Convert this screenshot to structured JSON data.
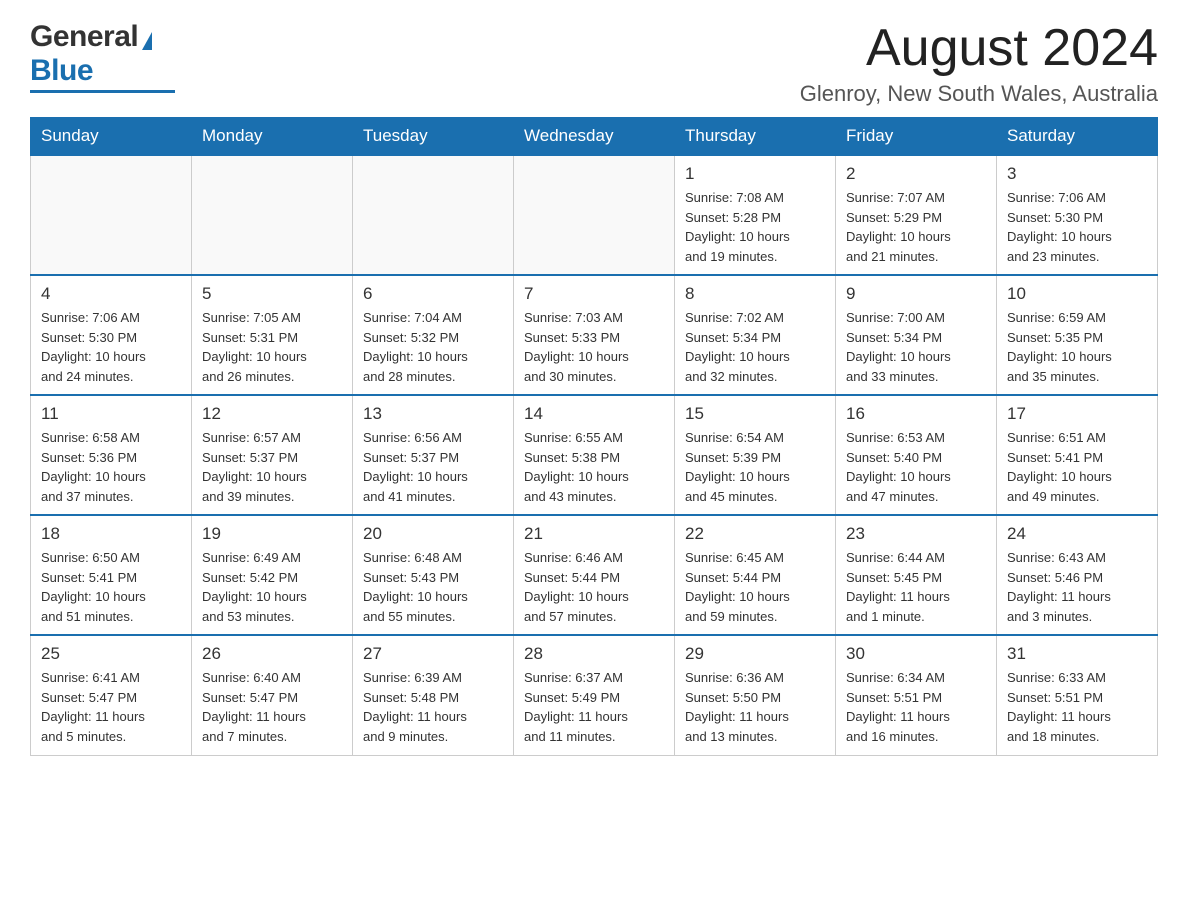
{
  "header": {
    "month_title": "August 2024",
    "location": "Glenroy, New South Wales, Australia"
  },
  "logo": {
    "general": "General",
    "blue": "Blue"
  },
  "days_of_week": [
    "Sunday",
    "Monday",
    "Tuesday",
    "Wednesday",
    "Thursday",
    "Friday",
    "Saturday"
  ],
  "weeks": [
    [
      {
        "day": "",
        "info": ""
      },
      {
        "day": "",
        "info": ""
      },
      {
        "day": "",
        "info": ""
      },
      {
        "day": "",
        "info": ""
      },
      {
        "day": "1",
        "info": "Sunrise: 7:08 AM\nSunset: 5:28 PM\nDaylight: 10 hours\nand 19 minutes."
      },
      {
        "day": "2",
        "info": "Sunrise: 7:07 AM\nSunset: 5:29 PM\nDaylight: 10 hours\nand 21 minutes."
      },
      {
        "day": "3",
        "info": "Sunrise: 7:06 AM\nSunset: 5:30 PM\nDaylight: 10 hours\nand 23 minutes."
      }
    ],
    [
      {
        "day": "4",
        "info": "Sunrise: 7:06 AM\nSunset: 5:30 PM\nDaylight: 10 hours\nand 24 minutes."
      },
      {
        "day": "5",
        "info": "Sunrise: 7:05 AM\nSunset: 5:31 PM\nDaylight: 10 hours\nand 26 minutes."
      },
      {
        "day": "6",
        "info": "Sunrise: 7:04 AM\nSunset: 5:32 PM\nDaylight: 10 hours\nand 28 minutes."
      },
      {
        "day": "7",
        "info": "Sunrise: 7:03 AM\nSunset: 5:33 PM\nDaylight: 10 hours\nand 30 minutes."
      },
      {
        "day": "8",
        "info": "Sunrise: 7:02 AM\nSunset: 5:34 PM\nDaylight: 10 hours\nand 32 minutes."
      },
      {
        "day": "9",
        "info": "Sunrise: 7:00 AM\nSunset: 5:34 PM\nDaylight: 10 hours\nand 33 minutes."
      },
      {
        "day": "10",
        "info": "Sunrise: 6:59 AM\nSunset: 5:35 PM\nDaylight: 10 hours\nand 35 minutes."
      }
    ],
    [
      {
        "day": "11",
        "info": "Sunrise: 6:58 AM\nSunset: 5:36 PM\nDaylight: 10 hours\nand 37 minutes."
      },
      {
        "day": "12",
        "info": "Sunrise: 6:57 AM\nSunset: 5:37 PM\nDaylight: 10 hours\nand 39 minutes."
      },
      {
        "day": "13",
        "info": "Sunrise: 6:56 AM\nSunset: 5:37 PM\nDaylight: 10 hours\nand 41 minutes."
      },
      {
        "day": "14",
        "info": "Sunrise: 6:55 AM\nSunset: 5:38 PM\nDaylight: 10 hours\nand 43 minutes."
      },
      {
        "day": "15",
        "info": "Sunrise: 6:54 AM\nSunset: 5:39 PM\nDaylight: 10 hours\nand 45 minutes."
      },
      {
        "day": "16",
        "info": "Sunrise: 6:53 AM\nSunset: 5:40 PM\nDaylight: 10 hours\nand 47 minutes."
      },
      {
        "day": "17",
        "info": "Sunrise: 6:51 AM\nSunset: 5:41 PM\nDaylight: 10 hours\nand 49 minutes."
      }
    ],
    [
      {
        "day": "18",
        "info": "Sunrise: 6:50 AM\nSunset: 5:41 PM\nDaylight: 10 hours\nand 51 minutes."
      },
      {
        "day": "19",
        "info": "Sunrise: 6:49 AM\nSunset: 5:42 PM\nDaylight: 10 hours\nand 53 minutes."
      },
      {
        "day": "20",
        "info": "Sunrise: 6:48 AM\nSunset: 5:43 PM\nDaylight: 10 hours\nand 55 minutes."
      },
      {
        "day": "21",
        "info": "Sunrise: 6:46 AM\nSunset: 5:44 PM\nDaylight: 10 hours\nand 57 minutes."
      },
      {
        "day": "22",
        "info": "Sunrise: 6:45 AM\nSunset: 5:44 PM\nDaylight: 10 hours\nand 59 minutes."
      },
      {
        "day": "23",
        "info": "Sunrise: 6:44 AM\nSunset: 5:45 PM\nDaylight: 11 hours\nand 1 minute."
      },
      {
        "day": "24",
        "info": "Sunrise: 6:43 AM\nSunset: 5:46 PM\nDaylight: 11 hours\nand 3 minutes."
      }
    ],
    [
      {
        "day": "25",
        "info": "Sunrise: 6:41 AM\nSunset: 5:47 PM\nDaylight: 11 hours\nand 5 minutes."
      },
      {
        "day": "26",
        "info": "Sunrise: 6:40 AM\nSunset: 5:47 PM\nDaylight: 11 hours\nand 7 minutes."
      },
      {
        "day": "27",
        "info": "Sunrise: 6:39 AM\nSunset: 5:48 PM\nDaylight: 11 hours\nand 9 minutes."
      },
      {
        "day": "28",
        "info": "Sunrise: 6:37 AM\nSunset: 5:49 PM\nDaylight: 11 hours\nand 11 minutes."
      },
      {
        "day": "29",
        "info": "Sunrise: 6:36 AM\nSunset: 5:50 PM\nDaylight: 11 hours\nand 13 minutes."
      },
      {
        "day": "30",
        "info": "Sunrise: 6:34 AM\nSunset: 5:51 PM\nDaylight: 11 hours\nand 16 minutes."
      },
      {
        "day": "31",
        "info": "Sunrise: 6:33 AM\nSunset: 5:51 PM\nDaylight: 11 hours\nand 18 minutes."
      }
    ]
  ]
}
